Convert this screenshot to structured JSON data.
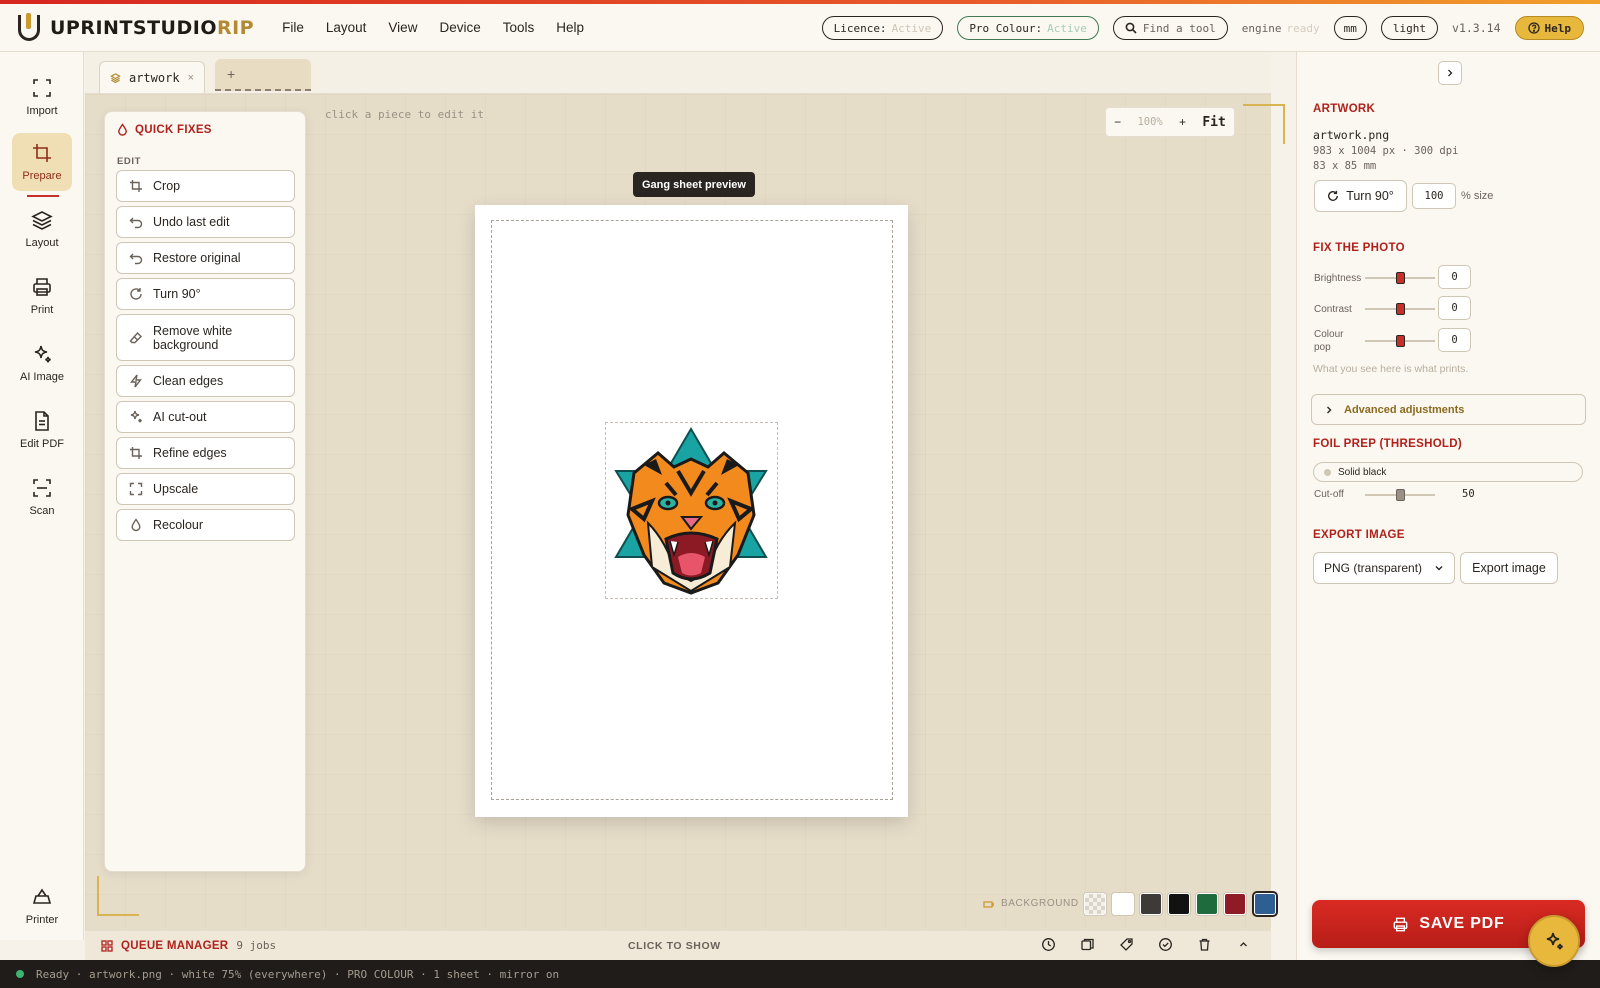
{
  "header": {
    "logo_part1": "UPRINTSTUDIO",
    "logo_part2": "RIP",
    "menu": [
      "File",
      "Layout",
      "View",
      "Device",
      "Tools",
      "Help"
    ],
    "licence_label": "Licence:",
    "licence_value": "Active",
    "pro_colour_label": "Pro Colour:",
    "pro_colour_value": "Active",
    "search_placeholder": "Find a tool",
    "engine_label": "engine",
    "engine_value": "ready",
    "units": "mm",
    "theme": "light",
    "version": "v1.3.14",
    "help_label": "Help"
  },
  "rail": {
    "items": [
      {
        "label": "Import",
        "icon": "import-icon"
      },
      {
        "label": "Prepare",
        "icon": "crop-icon"
      },
      {
        "label": "Layout",
        "icon": "layers-icon"
      },
      {
        "label": "Print",
        "icon": "printer-icon"
      },
      {
        "label": "AI Image",
        "icon": "sparkle-icon"
      },
      {
        "label": "Edit PDF",
        "icon": "document-icon"
      },
      {
        "label": "Scan",
        "icon": "scan-icon"
      }
    ],
    "bottom_label": "Printer"
  },
  "tabs": {
    "active_label": "artwork",
    "close": "×",
    "add": "+"
  },
  "canvas": {
    "hint": "click a piece to edit it",
    "zoom_pct": "100%",
    "zoom_minus": "−",
    "zoom_plus": "+",
    "zoom_fit": "Fit",
    "tooltip": "Gang sheet preview"
  },
  "quick_fixes": {
    "title": "QUICK FIXES",
    "section": "EDIT",
    "buttons": [
      "Crop",
      "Undo last edit",
      "Restore original",
      "Turn 90°",
      "Remove white background",
      "Clean edges",
      "AI cut-out",
      "Refine edges",
      "Upscale",
      "Recolour"
    ]
  },
  "background": {
    "label": "BACKGROUND",
    "swatches": [
      "#e8e3da",
      "#ffffff",
      "#3d3a37",
      "#121212",
      "#1e6b3e",
      "#8e1b26",
      "#2d5f93"
    ],
    "selected_index": 6
  },
  "queue": {
    "title": "QUEUE MANAGER",
    "jobs": "9 jobs",
    "toggle": "CLICK TO SHOW"
  },
  "status": {
    "text": "Ready · artwork.png · white 75% (everywhere) · PRO COLOUR · 1 sheet · mirror on"
  },
  "right_panel": {
    "artwork_heading": "ARTWORK",
    "filename": "artwork.png",
    "pixels": "983 x 1004 px · 300 dpi",
    "mm": "83 x 85 mm",
    "turn_label": "Turn 90°",
    "size_value": "100",
    "size_unit": "% size",
    "fix_heading": "FIX THE PHOTO",
    "adjustments": [
      {
        "label": "Brightness",
        "value": "0"
      },
      {
        "label": "Contrast",
        "value": "0"
      },
      {
        "label": "Colour pop",
        "value": "0"
      }
    ],
    "note": "What you see here is what prints.",
    "advanced": "Advanced adjustments",
    "foil_heading": "FOIL PREP (THRESHOLD)",
    "foil_toggle": "Solid black",
    "cutoff_label": "Cut-off",
    "cutoff_value": "50",
    "export_heading": "EXPORT IMAGE",
    "export_format": "PNG (transparent)",
    "export_button": "Export image",
    "save_pdf": "SAVE PDF"
  }
}
